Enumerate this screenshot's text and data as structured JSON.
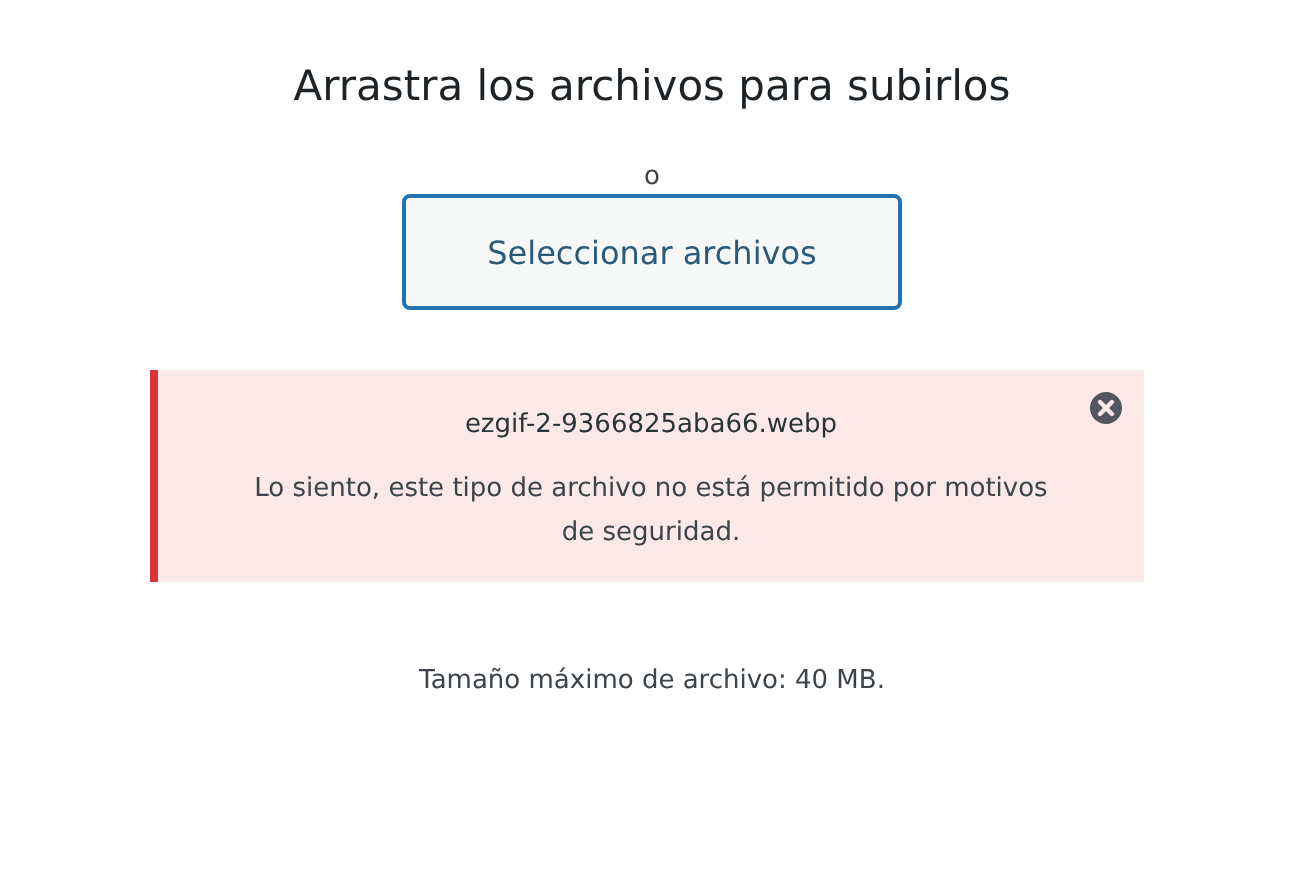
{
  "title": "Arrastra los archivos para subirlos",
  "separator": "o",
  "select_button": {
    "label": "Seleccionar archivos"
  },
  "error": {
    "filename": "ezgif-2-9366825aba66.webp",
    "message": "Lo siento, este tipo de archivo no está permitido por motivos de seguridad."
  },
  "max_size": "Tamaño máximo de archivo: 40 MB."
}
